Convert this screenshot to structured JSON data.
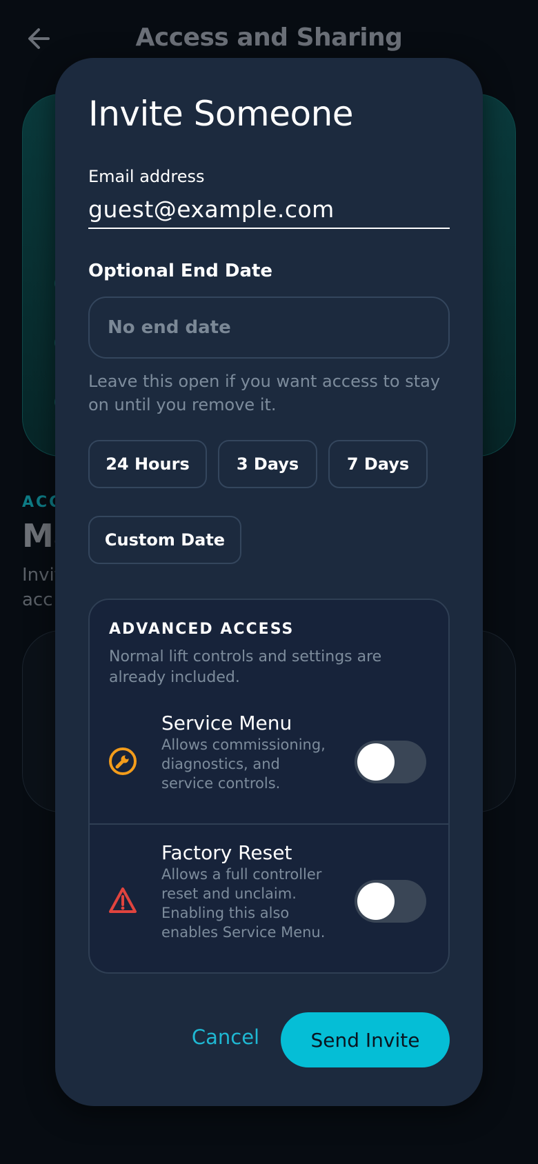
{
  "background": {
    "title": "Access and Sharing",
    "section_label": "ACC",
    "heading": "Ma",
    "subtitle_lines": [
      "Invit",
      "acc"
    ]
  },
  "modal": {
    "title": "Invite Someone",
    "email": {
      "label": "Email address",
      "value": "guest@example.com"
    },
    "end_date": {
      "label": "Optional End Date",
      "placeholder": "No end date",
      "helper": "Leave this open if you want access to stay on until you remove it."
    },
    "presets": [
      {
        "label": "24 Hours"
      },
      {
        "label": "3 Days"
      },
      {
        "label": "7 Days"
      },
      {
        "label": "Custom Date"
      }
    ],
    "advanced": {
      "title": "ADVANCED ACCESS",
      "description": "Normal lift controls and settings are already included.",
      "items": [
        {
          "icon": "wrench-icon",
          "title": "Service Menu",
          "description": "Allows commissioning, diagnostics, and service controls.",
          "enabled": false,
          "icon_color": "#f39c1b"
        },
        {
          "icon": "warning-icon",
          "title": "Factory Reset",
          "description": "Allows a full controller reset and unclaim. Enabling this also enables Service Menu.",
          "enabled": false,
          "icon_color": "#e0443e"
        }
      ]
    },
    "actions": {
      "cancel": "Cancel",
      "send": "Send Invite"
    }
  },
  "colors": {
    "accent": "#05bed6",
    "modal_bg": "#1c2a3e",
    "muted_text": "#7d8c9c"
  }
}
